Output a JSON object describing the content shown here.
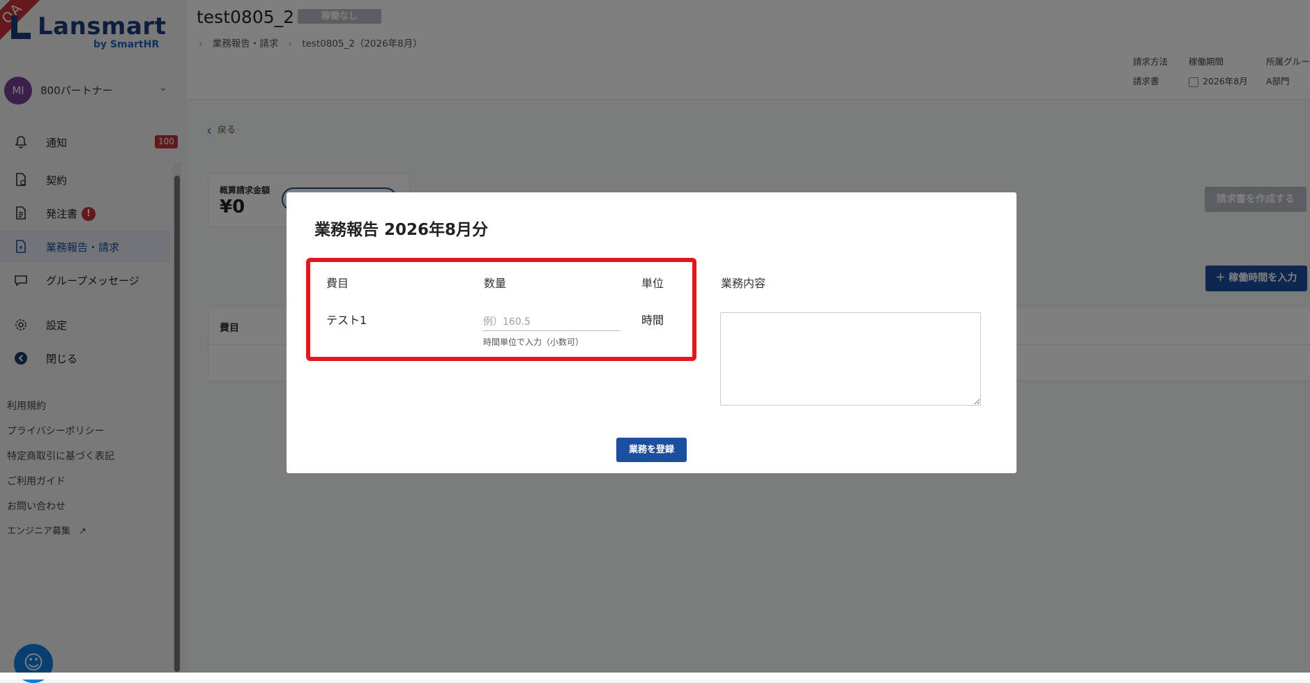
{
  "ribbon": "QA",
  "logo": {
    "name": "Lansmart",
    "sub": "by SmartHR"
  },
  "account": {
    "initials": "MI",
    "name": "800パートナー",
    "chevron": "⌄"
  },
  "nav": [
    {
      "label": "通知",
      "icon": "bell-icon",
      "glyph": "🔔",
      "badge": "100"
    },
    {
      "label": "契約",
      "icon": "contract-icon",
      "glyph": "▢"
    },
    {
      "label": "発注書",
      "icon": "document-icon",
      "glyph": "▤",
      "alert": "!"
    },
    {
      "label": "業務報告・請求",
      "icon": "invoice-icon",
      "glyph": "▣"
    },
    {
      "label": "グループメッセージ",
      "icon": "message-icon",
      "glyph": "◌"
    },
    {
      "label": "設定",
      "icon": "gear-icon",
      "glyph": "⚙"
    },
    {
      "label": "閉じる",
      "icon": "close-sidebar-icon",
      "glyph": "◀"
    }
  ],
  "footer_links": [
    "利用規約",
    "プライバシーポリシー",
    "特定商取引に基づく表記",
    "ご利用ガイド",
    "お問い合わせ",
    "エンジニア募集"
  ],
  "header": {
    "title": "test0805_2",
    "status": "稼働なし",
    "breadcrumb": [
      "業務報告・請求",
      "test0805_2（2026年8月）"
    ],
    "meta": [
      {
        "label": "請求方法",
        "value": "請求書"
      },
      {
        "label": "稼働期間",
        "value": "2026年8月"
      },
      {
        "label": "所属グルー",
        "value": "A部門"
      }
    ]
  },
  "main": {
    "back": "戻る",
    "summary_label": "概算請求金額",
    "summary_value": "¥0",
    "create_invoice": "請求書を作成する",
    "enter_hours": "＋ 稼働時間を入力",
    "table_header": "費目"
  },
  "modal": {
    "title": "業務報告 2026年8月分",
    "columns": {
      "item": "費目",
      "qty": "数量",
      "unit": "単位",
      "content": "業務内容"
    },
    "row": {
      "item": "テスト1",
      "qty_value": "",
      "qty_placeholder": "例）160.5",
      "qty_hint": "時間単位で入力（小数可）",
      "unit": "時間"
    },
    "submit": "業務を登録"
  },
  "colors": {
    "primary": "#1d4fa0",
    "highlight": "#e4151b",
    "badge": "#c5303a"
  }
}
